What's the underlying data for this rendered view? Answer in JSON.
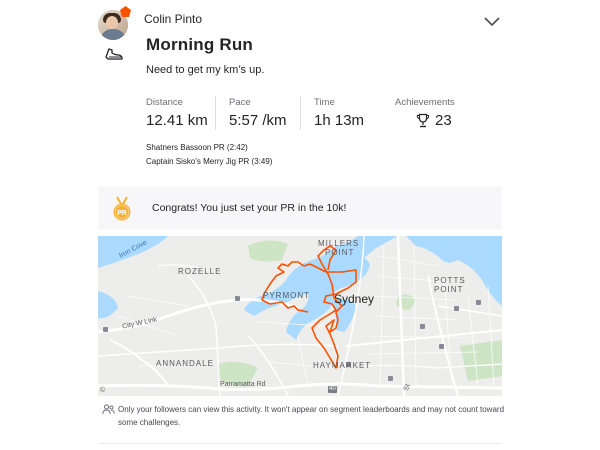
{
  "activity": {
    "athlete_name": "Colin Pinto",
    "title": "Morning Run",
    "description": "Need to get my km’s up.",
    "type_icon": "shoe-icon",
    "expand_icon": "chevron-down-icon"
  },
  "stats": [
    {
      "label": "Distance",
      "value": "12.41 km"
    },
    {
      "label": "Pace",
      "value": "5:57 /km"
    },
    {
      "label": "Time",
      "value": "1h 13m"
    },
    {
      "label": "Achievements",
      "value": "23"
    }
  ],
  "segments": [
    "Shatners Bassoon PR (2:42)",
    "Captain Sisko's Merry Jig PR (3:49)"
  ],
  "banner": {
    "text": "Congrats! You just set your PR in the 10k!",
    "medal_label": "PR"
  },
  "map": {
    "city": "Sydney",
    "labels": {
      "millers1": "MILLERS",
      "millers2": "POINT",
      "rozelle": "ROZELLE",
      "pyrmont": "PYRMONT",
      "potts1": "POTTS",
      "potts2": "POINT",
      "annandale": "ANNANDALE",
      "haymarket": "HAYMARKET",
      "iron_cove": "Iron Cove",
      "city_west_link": "City W Link",
      "parramatta": "Parramatta Rd",
      "hwy_num": "40",
      "st": "St"
    },
    "attribution": "©"
  },
  "privacy": {
    "text": "Only your followers can view this activity. It won't appear on segment leaderboards and may not count toward some challenges."
  },
  "colors": {
    "brand": "#fc5200",
    "route": "#fc5200",
    "water": "#aadaff",
    "park": "#cde5c4",
    "medal": "#f5b335"
  }
}
